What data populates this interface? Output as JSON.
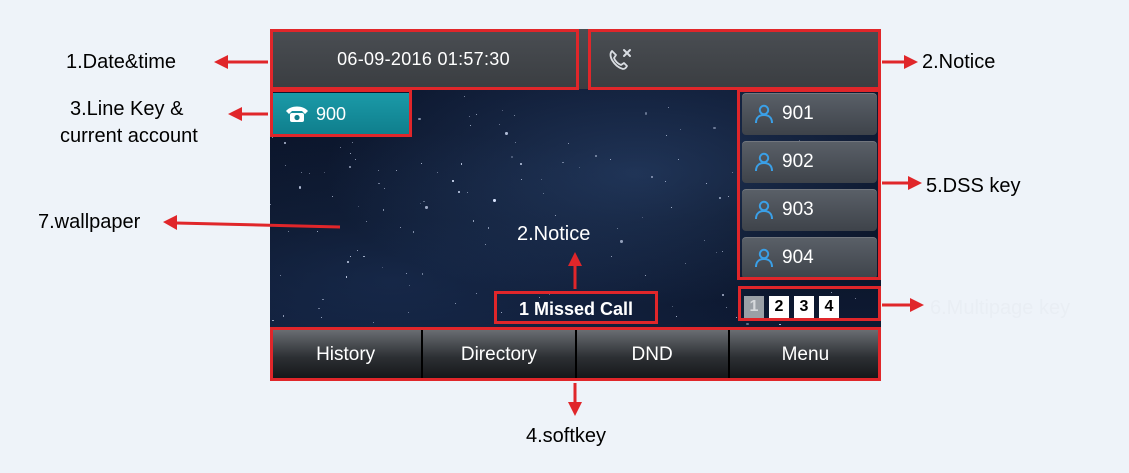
{
  "screen": {
    "datetime": "06-09-2016 01:57:30",
    "line_key": {
      "account": "900"
    },
    "dss_keys": [
      "901",
      "902",
      "903",
      "904"
    ],
    "pages": [
      "1",
      "2",
      "3",
      "4"
    ],
    "notice_text": "1 Missed Call",
    "softkeys": [
      "History",
      "Directory",
      "DND",
      "Menu"
    ]
  },
  "annotations": {
    "date_time": "1.Date&time",
    "notice_top": "2.Notice",
    "line_key_1": "3.Line Key &",
    "line_key_2": "current account",
    "softkey": "4.softkey",
    "dss_key": "5.DSS key",
    "multipage_key": "6.Multipage key",
    "wallpaper": "7.wallpaper",
    "notice_inner": "2.Notice"
  },
  "colors": {
    "annotation_red": "#e0262a",
    "line_key_teal": "#1b9aa8",
    "person_icon_blue": "#3aa0e8"
  },
  "icons": [
    "missed-call-icon",
    "phone-icon",
    "contact-person-icon"
  ]
}
